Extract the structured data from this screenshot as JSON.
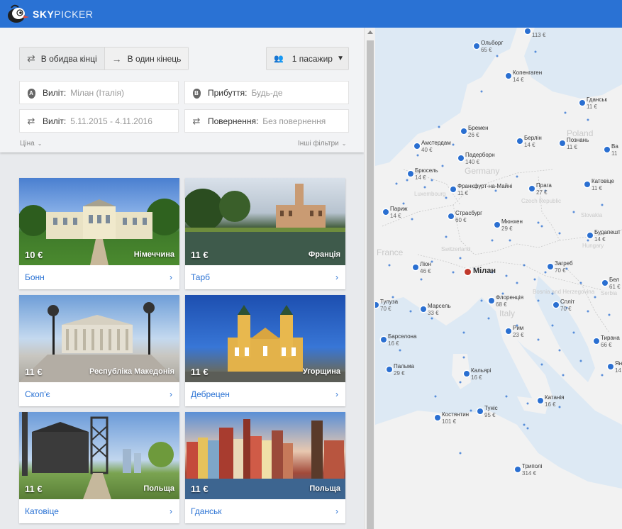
{
  "app": {
    "logo_bold": "SKY",
    "logo_thin": "PICKER"
  },
  "colors": {
    "brand": "#2a72d4",
    "map_dot": "#2a6fd1",
    "home_dot": "#c0392b"
  },
  "trip_type": {
    "return_label": "В обидва кінці",
    "oneway_label": "В один кінець"
  },
  "passengers": {
    "label": "1 пасажир"
  },
  "fields": {
    "from_label": "Виліт:",
    "from_value": "Мілан (Італія)",
    "to_label": "Прибуття:",
    "to_value": "Будь-де",
    "dates_label": "Виліт:",
    "dates_value": "5.11.2015 - 4.11.2016",
    "return_label": "Повернення:",
    "return_value": "Без повернення"
  },
  "filters": {
    "price": "Ціна",
    "other": "Інші фільтри"
  },
  "cards": [
    {
      "price": "10 €",
      "country": "Німеччина",
      "city": "Бонн"
    },
    {
      "price": "11 €",
      "country": "Франція",
      "city": "Тарб"
    },
    {
      "price": "11 €",
      "country": "Республіка Македонія",
      "city": "Скоп'є"
    },
    {
      "price": "11 €",
      "country": "Угорщина",
      "city": "Дебрецен"
    },
    {
      "price": "11 €",
      "country": "Польща",
      "city": "Катовіце"
    },
    {
      "price": "11 €",
      "country": "Польща",
      "city": "Гданськ"
    }
  ],
  "map": {
    "home": "Мілан",
    "regions": [
      "Poland",
      "Germany",
      "Czech Republic",
      "Slovakia",
      "Hungary",
      "France",
      "Switzerland",
      "Italy",
      "Bosnia and Herzegovina",
      "Serbia",
      "Luxembourg"
    ],
    "cities": [
      {
        "name": "Ольборг",
        "price": "65 €"
      },
      {
        "name": "Копенгаген",
        "price": "14 €"
      },
      {
        "name": "Гданськ",
        "price": "11 €"
      },
      {
        "name": "Бремен",
        "price": "26 €"
      },
      {
        "name": "Амстердам",
        "price": "40 €"
      },
      {
        "name": "Берлін",
        "price": "14 €"
      },
      {
        "name": "Познань",
        "price": "11 €"
      },
      {
        "name": "Падерборн",
        "price": "140 €"
      },
      {
        "name": "Брюсель",
        "price": "14 €"
      },
      {
        "name": "Франкфурт-на-Майні",
        "price": "11 €"
      },
      {
        "name": "Прага",
        "price": "27 €"
      },
      {
        "name": "Катовіце",
        "price": "11 €"
      },
      {
        "name": "Париж",
        "price": "14 €"
      },
      {
        "name": "Страсбург",
        "price": "60 €"
      },
      {
        "name": "Мюнхен",
        "price": "29 €"
      },
      {
        "name": "Будапешт",
        "price": "14 €"
      },
      {
        "name": "Ліон",
        "price": "46 €"
      },
      {
        "name": "Загреб",
        "price": "70 €"
      },
      {
        "name": "Тулуза",
        "price": "70 €"
      },
      {
        "name": "Марсель",
        "price": "33 €"
      },
      {
        "name": "Флоренція",
        "price": "68 €"
      },
      {
        "name": "Спліт",
        "price": "70 €"
      },
      {
        "name": "Рим",
        "price": "23 €"
      },
      {
        "name": "Барселона",
        "price": "16 €"
      },
      {
        "name": "Тирана",
        "price": "66 €"
      },
      {
        "name": "Пальма",
        "price": "29 €"
      },
      {
        "name": "Кальярі",
        "price": "16 €"
      },
      {
        "name": "Катанія",
        "price": "16 €"
      },
      {
        "name": "Костянтин",
        "price": "101 €"
      },
      {
        "name": "Туніс",
        "price": "95 €"
      },
      {
        "name": "Триполі",
        "price": "314 €"
      },
      {
        "name": "Бел",
        "price": "61 €"
      },
      {
        "name": "Ян",
        "price": "14 €"
      },
      {
        "name": "Ва",
        "price": "11"
      },
      {
        "name": "",
        "price": "113 €"
      }
    ]
  }
}
